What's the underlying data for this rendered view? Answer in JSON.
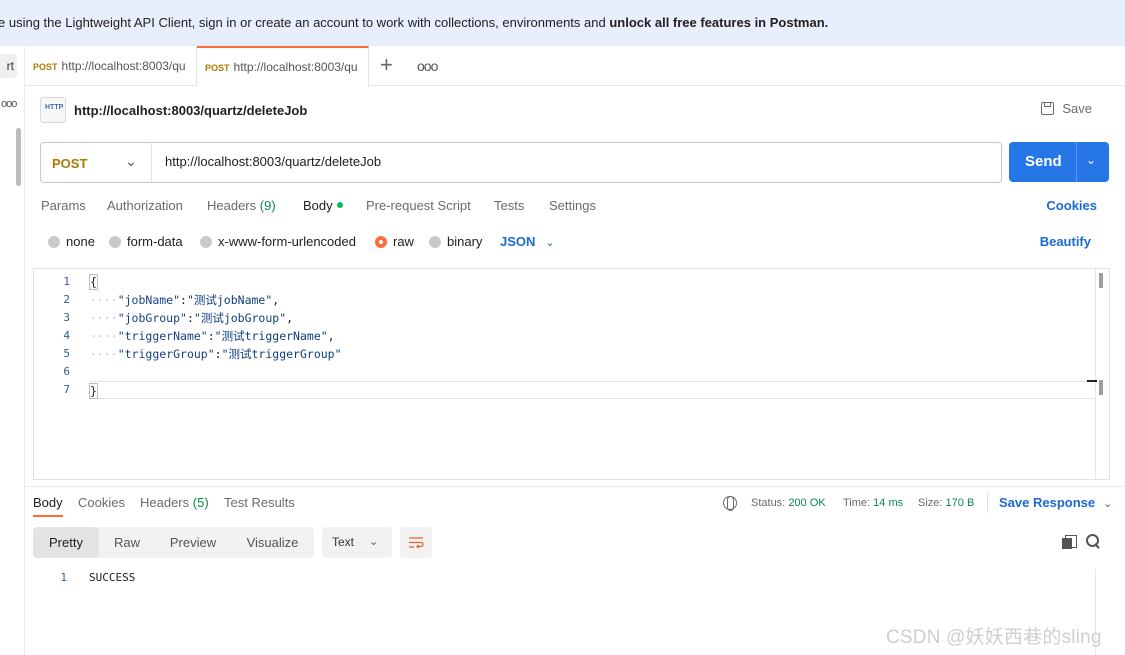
{
  "banner": {
    "text": "e using the Lightweight API Client, sign in or create an account to work with collections, environments and ",
    "bold": "unlock all free features in Postman."
  },
  "left_rail": {
    "chip": "rt",
    "dots": "ooo"
  },
  "tabs": [
    {
      "method": "POST",
      "label": "http://localhost:8003/qu"
    },
    {
      "method": "POST",
      "label": "http://localhost:8003/qu"
    }
  ],
  "icons": {
    "new_tab": "plus-icon",
    "more": "ellipsis-icon",
    "http": "http-icon",
    "save": "save-icon",
    "send_dropdown": "chevron-down-icon",
    "network": "globe-icon",
    "copy": "copy-icon",
    "search": "search-icon",
    "wrap": "wrap-lines-icon"
  },
  "request": {
    "title": "http://localhost:8003/quartz/deleteJob",
    "save_label": "Save",
    "method": "POST",
    "url": "http://localhost:8003/quartz/deleteJob",
    "send_label": "Send"
  },
  "request_tabs": {
    "params": "Params",
    "authorization": "Authorization",
    "headers": "Headers",
    "headers_count": "(9)",
    "body": "Body",
    "prerequest": "Pre-request Script",
    "tests": "Tests",
    "settings": "Settings",
    "cookies": "Cookies"
  },
  "body_types": {
    "none": "none",
    "form_data": "form-data",
    "urlencoded": "x-www-form-urlencoded",
    "raw": "raw",
    "binary": "binary",
    "format": "JSON",
    "beautify": "Beautify"
  },
  "editor": {
    "line_numbers": [
      "1",
      "2",
      "3",
      "4",
      "5",
      "6",
      "7"
    ],
    "lines": {
      "open": "{",
      "l2_key": "\"jobName\"",
      "l2_val": "\"测试jobName\"",
      "l3_key": "\"jobGroup\"",
      "l3_val": "\"测试jobGroup\"",
      "l4_key": "\"triggerName\"",
      "l4_val": "\"测试triggerName\"",
      "l5_key": "\"triggerGroup\"",
      "l5_val": "\"测试triggerGroup\"",
      "close": "}"
    }
  },
  "response_tabs": {
    "body": "Body",
    "cookies": "Cookies",
    "headers": "Headers",
    "headers_count": "(5)",
    "test_results": "Test Results"
  },
  "status": {
    "status_label": "Status:",
    "status_value": "200 OK",
    "time_label": "Time:",
    "time_value": "14 ms",
    "size_label": "Size:",
    "size_value": "170 B",
    "save_response": "Save Response"
  },
  "response_view": {
    "pretty": "Pretty",
    "raw": "Raw",
    "preview": "Preview",
    "visualize": "Visualize",
    "format": "Text"
  },
  "response_body": {
    "line": "1",
    "text": "SUCCESS"
  },
  "watermark": "CSDN @妖妖西巷的sling"
}
